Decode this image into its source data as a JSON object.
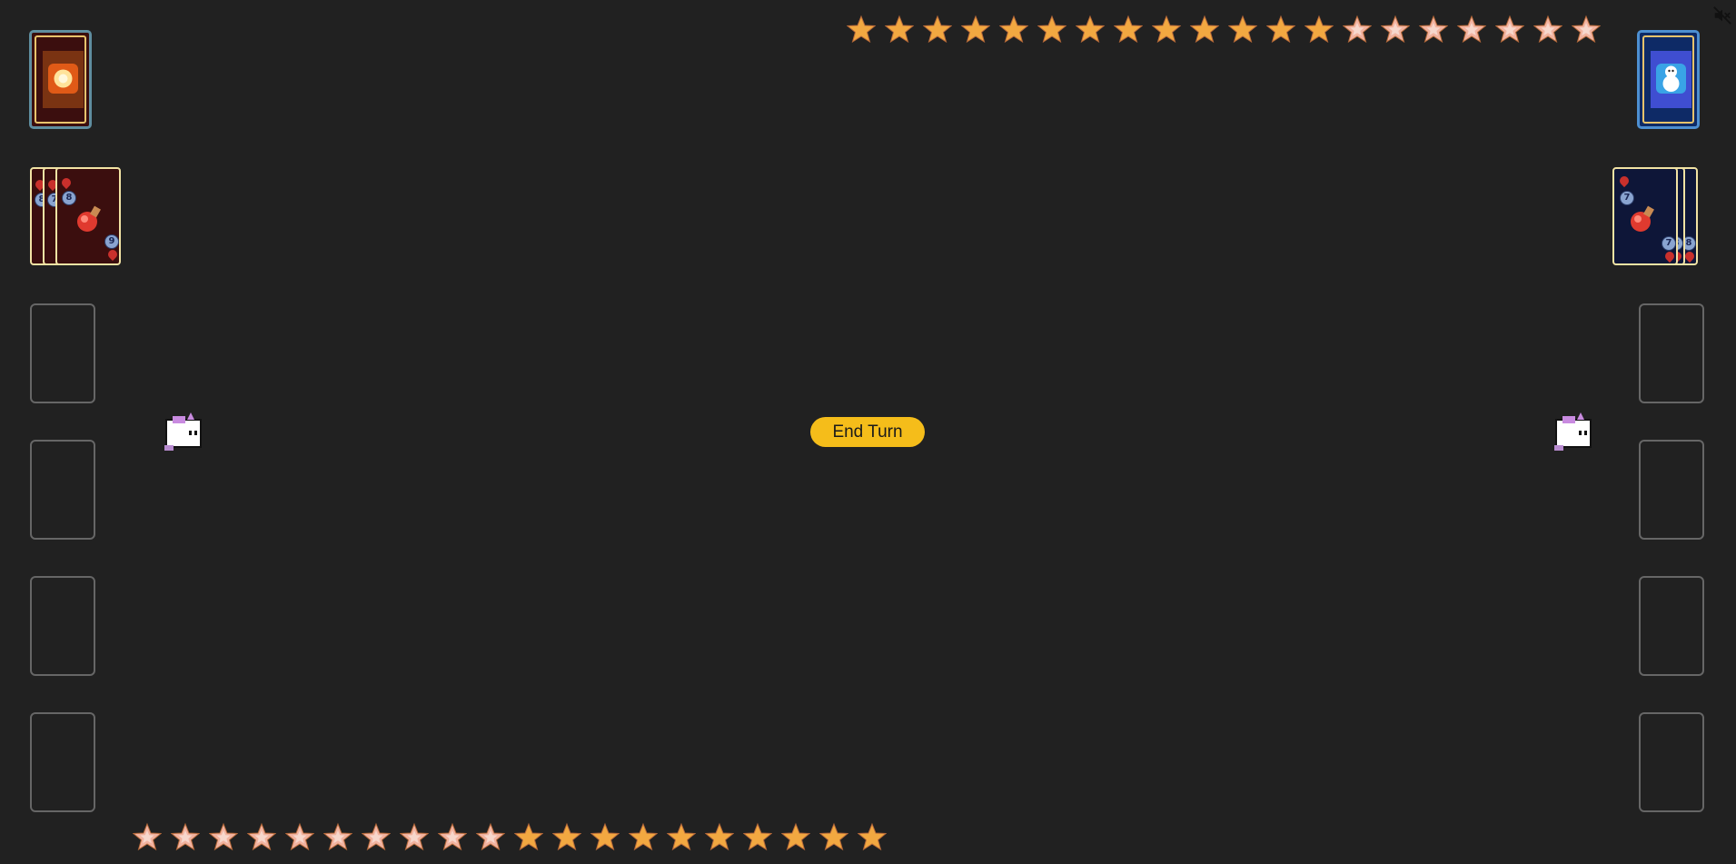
{
  "controls": {
    "end_turn_label": "End Turn",
    "mute_icon": "speaker-muted-icon"
  },
  "opponent": {
    "deck_icon": "sun-burst-icon",
    "hand_count": 3,
    "hand_cards": [
      {
        "cost": "8",
        "power": "8",
        "art": "red-potion-icon"
      },
      {
        "cost": "7",
        "power": "",
        "art": "red-potion-icon"
      },
      {
        "cost": "8",
        "power": "9",
        "art": "red-potion-icon"
      }
    ],
    "star_row": {
      "total": 20,
      "filled": 13
    },
    "avatar": "unicorn-icon",
    "board_slots": 4
  },
  "player": {
    "deck_icon": "snowman-icon",
    "hand_count": 3,
    "hand_cards": [
      {
        "cost": "7",
        "power": "7",
        "art": "red-potion-icon"
      },
      {
        "cost": "",
        "power": "8",
        "art": "red-potion-icon"
      },
      {
        "cost": "",
        "power": "8",
        "art": "red-potion-icon"
      }
    ],
    "star_row": {
      "total": 20,
      "filled": 10
    },
    "avatar": "unicorn-icon",
    "board_slots": 4
  },
  "colors": {
    "background": "#212121",
    "star_gold": "#f2a841",
    "star_pink": "#f2b3a0",
    "button": "#f5bd1a",
    "opponent_card": "#3b0e0e",
    "player_card": "#0e1638",
    "slot_border": "#666666"
  }
}
